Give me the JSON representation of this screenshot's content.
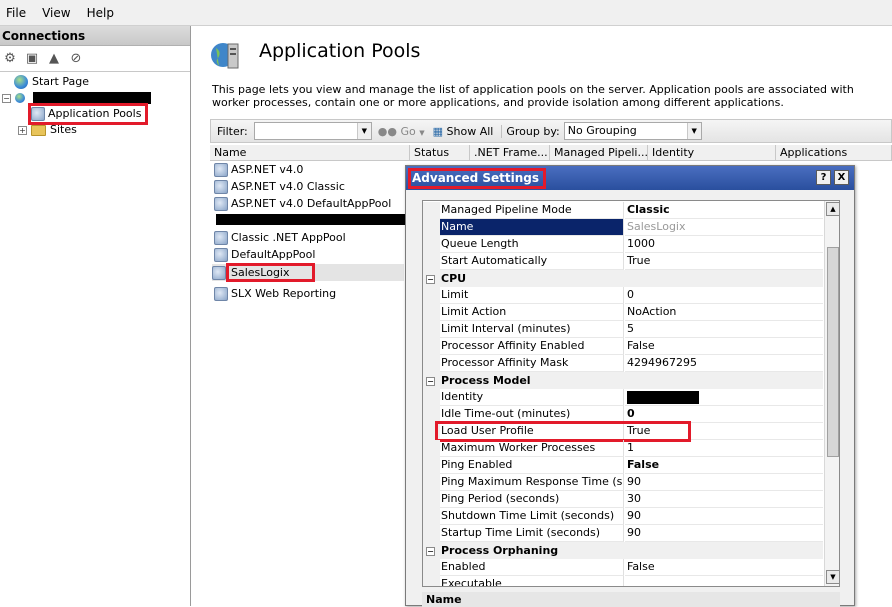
{
  "menu": [
    "File",
    "View",
    "Help"
  ],
  "connections": {
    "header": "Connections",
    "tree": {
      "start_page": "Start Page",
      "app_pools": "Application Pools",
      "sites": "Sites"
    }
  },
  "main": {
    "title": "Application Pools",
    "description": "This page lets you view and manage the list of application pools on the server. Application pools are associated with worker processes, contain one or more applications, and provide isolation among different applications.",
    "filter_label": "Filter:",
    "go_label": "Go",
    "show_all_label": "Show All",
    "group_by_label": "Group by:",
    "group_by_value": "No Grouping",
    "columns": [
      "Name",
      "Status",
      ".NET Frame...",
      "Managed Pipeli...",
      "Identity",
      "Applications"
    ],
    "pools": [
      "ASP.NET v4.0",
      "ASP.NET v4.0 Classic",
      "ASP.NET v4.0 DefaultAppPool",
      "",
      "Classic .NET AppPool",
      "DefaultAppPool",
      "SalesLogix",
      "SLX Web Reporting"
    ]
  },
  "dialog": {
    "title": "Advanced Settings",
    "help_btn": "?",
    "close_btn": "X",
    "rows": {
      "pipeline": [
        "Managed Pipeline Mode",
        "Classic"
      ],
      "name": [
        "Name",
        "SalesLogix"
      ],
      "queue": [
        "Queue Length",
        "1000"
      ],
      "start_auto": [
        "Start Automatically",
        "True"
      ],
      "cpu": "CPU",
      "limit": [
        "Limit",
        "0"
      ],
      "limit_action": [
        "Limit Action",
        "NoAction"
      ],
      "limit_interval": [
        "Limit Interval (minutes)",
        "5"
      ],
      "affinity_enabled": [
        "Processor Affinity Enabled",
        "False"
      ],
      "affinity_mask": [
        "Processor Affinity Mask",
        "4294967295"
      ],
      "process_model": "Process Model",
      "identity": [
        "Identity",
        ""
      ],
      "idle_timeout": [
        "Idle Time-out (minutes)",
        "0"
      ],
      "load_user_profile": [
        "Load User Profile",
        "True"
      ],
      "max_worker": [
        "Maximum Worker Processes",
        "1"
      ],
      "ping_enabled": [
        "Ping Enabled",
        "False"
      ],
      "ping_max": [
        "Ping Maximum Response Time (seconds)",
        "90"
      ],
      "ping_period": [
        "Ping Period (seconds)",
        "30"
      ],
      "shutdown": [
        "Shutdown Time Limit (seconds)",
        "90"
      ],
      "startup": [
        "Startup Time Limit (seconds)",
        "90"
      ],
      "orphaning": "Process Orphaning",
      "orph_enabled": [
        "Enabled",
        "False"
      ],
      "executable": [
        "Executable",
        ""
      ]
    },
    "description_title": "Name"
  }
}
